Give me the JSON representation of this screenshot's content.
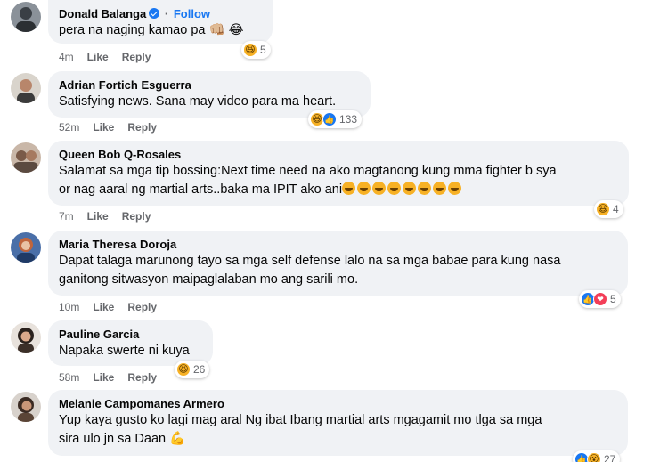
{
  "colors": {
    "bubble_bg": "#f0f2f5",
    "follow_blue": "#1877f2",
    "meta_gray": "#65676b",
    "haha": "#f7b125",
    "love": "#f33e58"
  },
  "comments": [
    {
      "author": "Donald Balanga",
      "verified_icon": "verified-badge-icon",
      "follow_label": "Follow",
      "text": "pera na naging kamao pa 👊🏼 😂",
      "time": "4m",
      "like": "Like",
      "reply": "Reply",
      "reactions": [
        "haha"
      ],
      "reaction_count": "5"
    },
    {
      "author": "Adrian Fortich Esguerra",
      "text": "Satisfying news. Sana may video para ma heart.",
      "time": "52m",
      "like": "Like",
      "reply": "Reply",
      "reactions": [
        "haha",
        "like"
      ],
      "reaction_count": "133"
    },
    {
      "author": "Queen Bob Q-Rosales",
      "text_line1": "Salamat sa mga tip bossing:Next time need na ako magtanong kung mma fighter b sya",
      "text_line2": "or nag aaral ng martial arts..baka ma IPIT ako ani",
      "inline_emoji_count": 8,
      "time": "7m",
      "like": "Like",
      "reply": "Reply",
      "reactions": [
        "haha"
      ],
      "reaction_count": "4"
    },
    {
      "author": "Maria Theresa Doroja",
      "text_line1": "Dapat talaga marunong tayo sa mga self defense lalo na sa mga babae para kung nasa",
      "text_line2": "ganitong sitwasyon maipaglalaban mo ang sarili mo.",
      "time": "10m",
      "like": "Like",
      "reply": "Reply",
      "reactions": [
        "like",
        "love"
      ],
      "reaction_count": "5"
    },
    {
      "author": "Pauline Garcia",
      "text": "Napaka swerte ni kuya",
      "time": "58m",
      "like": "Like",
      "reply": "Reply",
      "reactions": [
        "haha"
      ],
      "reaction_count": "26"
    },
    {
      "author": "Melanie Campomanes Armero",
      "text_line1": "Yup kaya gusto ko lagi mag aral Ng ibat Ibang martial arts mgagamit mo tlga sa mga",
      "text_line2": "sira ulo jn sa Daan 💪",
      "reactions": [
        "like",
        "haha"
      ],
      "reaction_count": "27"
    }
  ]
}
